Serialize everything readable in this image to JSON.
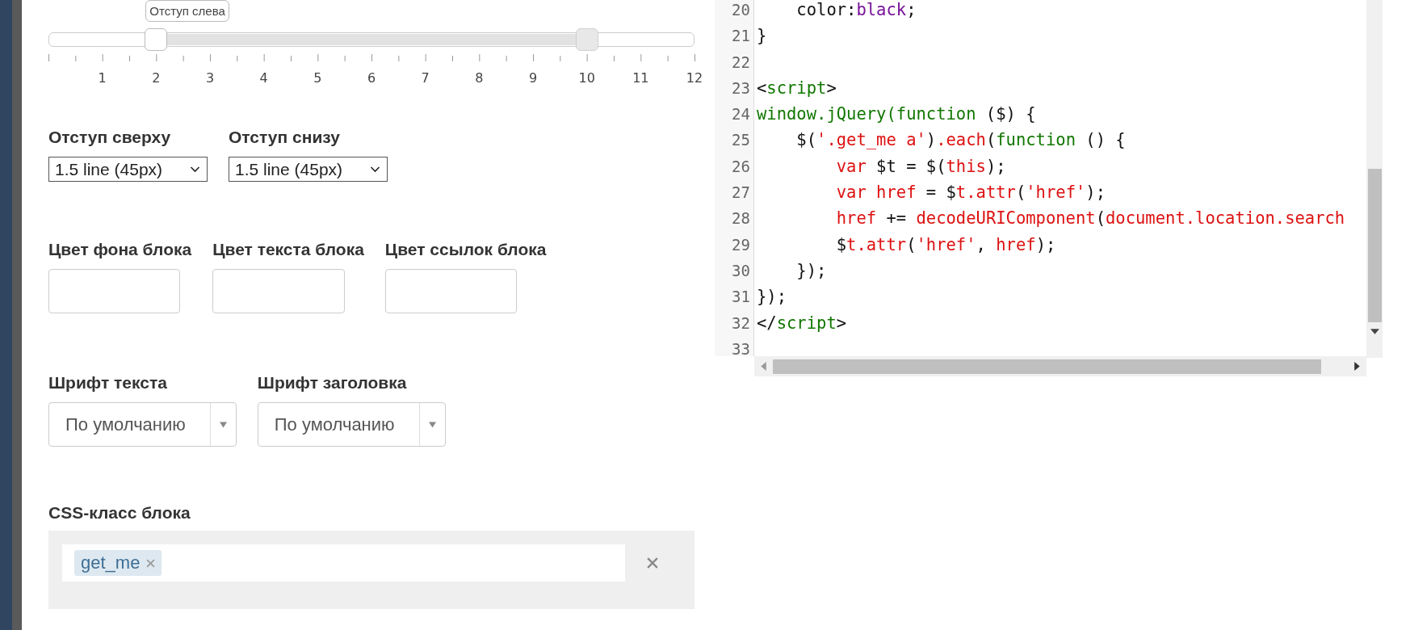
{
  "slider": {
    "tooltip": "Отступ слева",
    "handles": [
      {
        "level": 0.1667
      },
      {
        "level": 0.8333
      }
    ],
    "ticks": [
      {
        "label": "1"
      },
      {
        "label": "2"
      },
      {
        "label": "3"
      },
      {
        "label": "4"
      },
      {
        "label": "5"
      },
      {
        "label": "6"
      },
      {
        "label": "7"
      },
      {
        "label": "8"
      },
      {
        "label": "9"
      },
      {
        "label": "10"
      },
      {
        "label": "11"
      },
      {
        "label": "12"
      }
    ]
  },
  "spacing": [
    {
      "label": "Отступ сверху",
      "value": "1.5 line (45px)"
    },
    {
      "label": "Отступ снизу",
      "value": "1.5 line (45px)"
    }
  ],
  "colors": [
    {
      "label": "Цвет фона блока"
    },
    {
      "label": "Цвет текста блока"
    },
    {
      "label": "Цвет ссылок блока"
    }
  ],
  "fonts": [
    {
      "label": "Шрифт текста",
      "value": "По умолчанию"
    },
    {
      "label": "Шрифт заголовка",
      "value": "По умолчанию"
    }
  ],
  "css_class": {
    "label": "CSS-класс блока",
    "tags": [
      "get_me"
    ]
  },
  "code": {
    "lines": [
      {
        "number": "20",
        "tokens": [
          {
            "text": "    color:",
            "kind": "plain"
          },
          {
            "text": "black",
            "kind": "value"
          },
          {
            "text": ";",
            "kind": "plain"
          }
        ]
      },
      {
        "number": "21",
        "tokens": [
          {
            "text": "}",
            "kind": "plain"
          }
        ]
      },
      {
        "number": "22"
      },
      {
        "number": "23",
        "tokens": [
          {
            "text": "<",
            "kind": "plain"
          },
          {
            "text": "script",
            "kind": "tag"
          },
          {
            "text": ">",
            "kind": "plain"
          }
        ]
      },
      {
        "number": "24",
        "tokens": [
          {
            "text": "window.jQuery(function",
            "kind": "tag"
          },
          {
            "text": " ($) {",
            "kind": "plain"
          }
        ]
      },
      {
        "number": "25",
        "tokens": [
          {
            "text": "    $(",
            "kind": "plain"
          },
          {
            "text": "'.get_me a'",
            "kind": "string"
          },
          {
            "text": ")",
            "kind": "plain"
          },
          {
            "text": ".each",
            "kind": "string"
          },
          {
            "text": "(",
            "kind": "plain"
          },
          {
            "text": "function",
            "kind": "tag"
          },
          {
            "text": " () {",
            "kind": "plain"
          }
        ]
      },
      {
        "number": "26",
        "tokens": [
          {
            "text": "        var",
            "kind": "string"
          },
          {
            "text": " $t = $(",
            "kind": "plain"
          },
          {
            "text": "this",
            "kind": "string"
          },
          {
            "text": ");",
            "kind": "plain"
          }
        ]
      },
      {
        "number": "27",
        "tokens": [
          {
            "text": "        var href",
            "kind": "string"
          },
          {
            "text": " = $",
            "kind": "plain"
          },
          {
            "text": "t.attr",
            "kind": "string"
          },
          {
            "text": "(",
            "kind": "plain"
          },
          {
            "text": "'href'",
            "kind": "string"
          },
          {
            "text": ");",
            "kind": "plain"
          }
        ]
      },
      {
        "number": "28",
        "tokens": [
          {
            "text": "        href",
            "kind": "string"
          },
          {
            "text": " += ",
            "kind": "plain"
          },
          {
            "text": "decodeURIComponent",
            "kind": "string"
          },
          {
            "text": "(",
            "kind": "plain"
          },
          {
            "text": "document.location.search",
            "kind": "string"
          }
        ]
      },
      {
        "number": "29",
        "tokens": [
          {
            "text": "        $",
            "kind": "plain"
          },
          {
            "text": "t.attr",
            "kind": "string"
          },
          {
            "text": "(",
            "kind": "plain"
          },
          {
            "text": "'href'",
            "kind": "string"
          },
          {
            "text": ", ",
            "kind": "plain"
          },
          {
            "text": "href",
            "kind": "string"
          },
          {
            "text": ");",
            "kind": "plain"
          }
        ]
      },
      {
        "number": "30",
        "tokens": [
          {
            "text": "    });",
            "kind": "plain"
          }
        ]
      },
      {
        "number": "31",
        "tokens": [
          {
            "text": "});",
            "kind": "plain"
          }
        ]
      },
      {
        "number": "32",
        "tokens": [
          {
            "text": "</",
            "kind": "plain"
          },
          {
            "text": "script",
            "kind": "tag"
          },
          {
            "text": ">",
            "kind": "plain"
          }
        ]
      },
      {
        "number": "33"
      }
    ]
  }
}
